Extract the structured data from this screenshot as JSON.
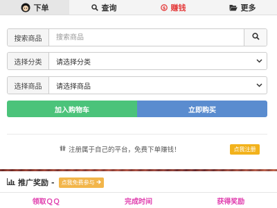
{
  "colors": {
    "accent_red": "#e43b3b",
    "cart_green": "#4bc37a",
    "buy_blue": "#5a8ccf",
    "register_orange": "#f2b21c",
    "promo_pink": "#e03fae"
  },
  "tabs": [
    {
      "label": "下单",
      "icon": "avatar-icon",
      "active": true
    },
    {
      "label": "查询",
      "icon": "search-icon"
    },
    {
      "label": "赚钱",
      "icon": "coin-icon"
    },
    {
      "label": "更多",
      "icon": "folder-open-icon"
    }
  ],
  "form": {
    "search_label": "搜索商品",
    "search_placeholder": "搜索商品",
    "category_label": "选择分类",
    "category_value": "请选择分类",
    "product_label": "选择商品",
    "product_value": "请选择商品"
  },
  "buttons": {
    "cart": "加入购物车",
    "buy": "立即购买"
  },
  "register": {
    "text": "注册属于自己的平台，免费下单赚钱！",
    "button": "点我注册"
  },
  "promo": {
    "title": "推广奖励",
    "separator": "-",
    "button": "点我免费参与",
    "tabs": [
      "领取ＱＱ",
      "完成时间",
      "获得奖励"
    ]
  }
}
